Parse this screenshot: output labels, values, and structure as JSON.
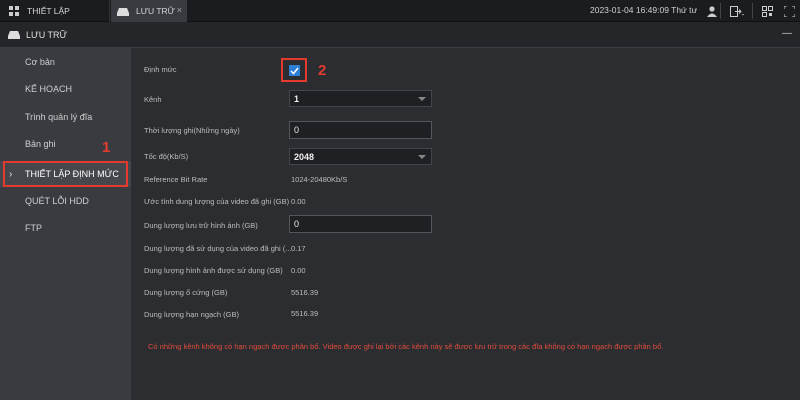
{
  "tabs": [
    {
      "label": "THIẾT LẬP",
      "icon": "grid-icon"
    },
    {
      "label": "LƯU TRỮ",
      "icon": "hdd-icon",
      "close": "×"
    }
  ],
  "header": {
    "datetime": "2023-01-04 16:49:09 Thứ tư"
  },
  "section": {
    "title": "LƯU TRỮ",
    "minimize": "—"
  },
  "sidebar": {
    "items": [
      {
        "label": "Cơ bản"
      },
      {
        "label": "KẾ HOẠCH"
      },
      {
        "label": "Trình quản lý đĩa"
      },
      {
        "label": "Bản ghi"
      },
      {
        "label": "THIẾT LẬP ĐỊNH MỨC",
        "active": true
      },
      {
        "label": "QUÉT LỖI HDD"
      },
      {
        "label": "FTP"
      }
    ]
  },
  "annotations": {
    "one": "1",
    "two": "2"
  },
  "form": {
    "quota_label": "Định mức",
    "quota_checked": true,
    "channel_label": "Kênh",
    "channel_value": "1",
    "record_days_label": "Thời lượng ghi(Những ngày)",
    "record_days_value": "0",
    "bitrate_label": "Tốc độ(Kb/S)",
    "bitrate_value": "2048",
    "ref_bitrate_label": "Reference Bit Rate",
    "ref_bitrate_value": "1024-20480Kb/S",
    "est_video_label": "Ước tính dung lượng của video đã ghi (GB)",
    "est_video_value": "0.00",
    "image_capacity_label": "Dung lượng lưu trữ hình ảnh (GB)",
    "image_capacity_value": "0",
    "used_video_label": "Dung lượng đã sử dụng của video đã ghi (...",
    "used_video_value": "0.17",
    "used_image_label": "Dung lượng hình ảnh được sử dụng (GB)",
    "used_image_value": "0.00",
    "hdd_capacity_label": "Dung lượng ổ cứng (GB)",
    "hdd_capacity_value": "5516.39",
    "quota_capacity_label": "Dung lượng hạn ngạch (GB)",
    "quota_capacity_value": "5516.39"
  },
  "notice": "Có những kênh không có hạn ngạch được phân bổ. Video được ghi lại bởi các kênh này sẽ được lưu trữ trong các đĩa không có hạn ngạch được phân bổ.",
  "colors": {
    "accent_red": "#e53b2f",
    "checkbox_blue": "#2f7fd6",
    "notice_red": "#e24d3c"
  }
}
